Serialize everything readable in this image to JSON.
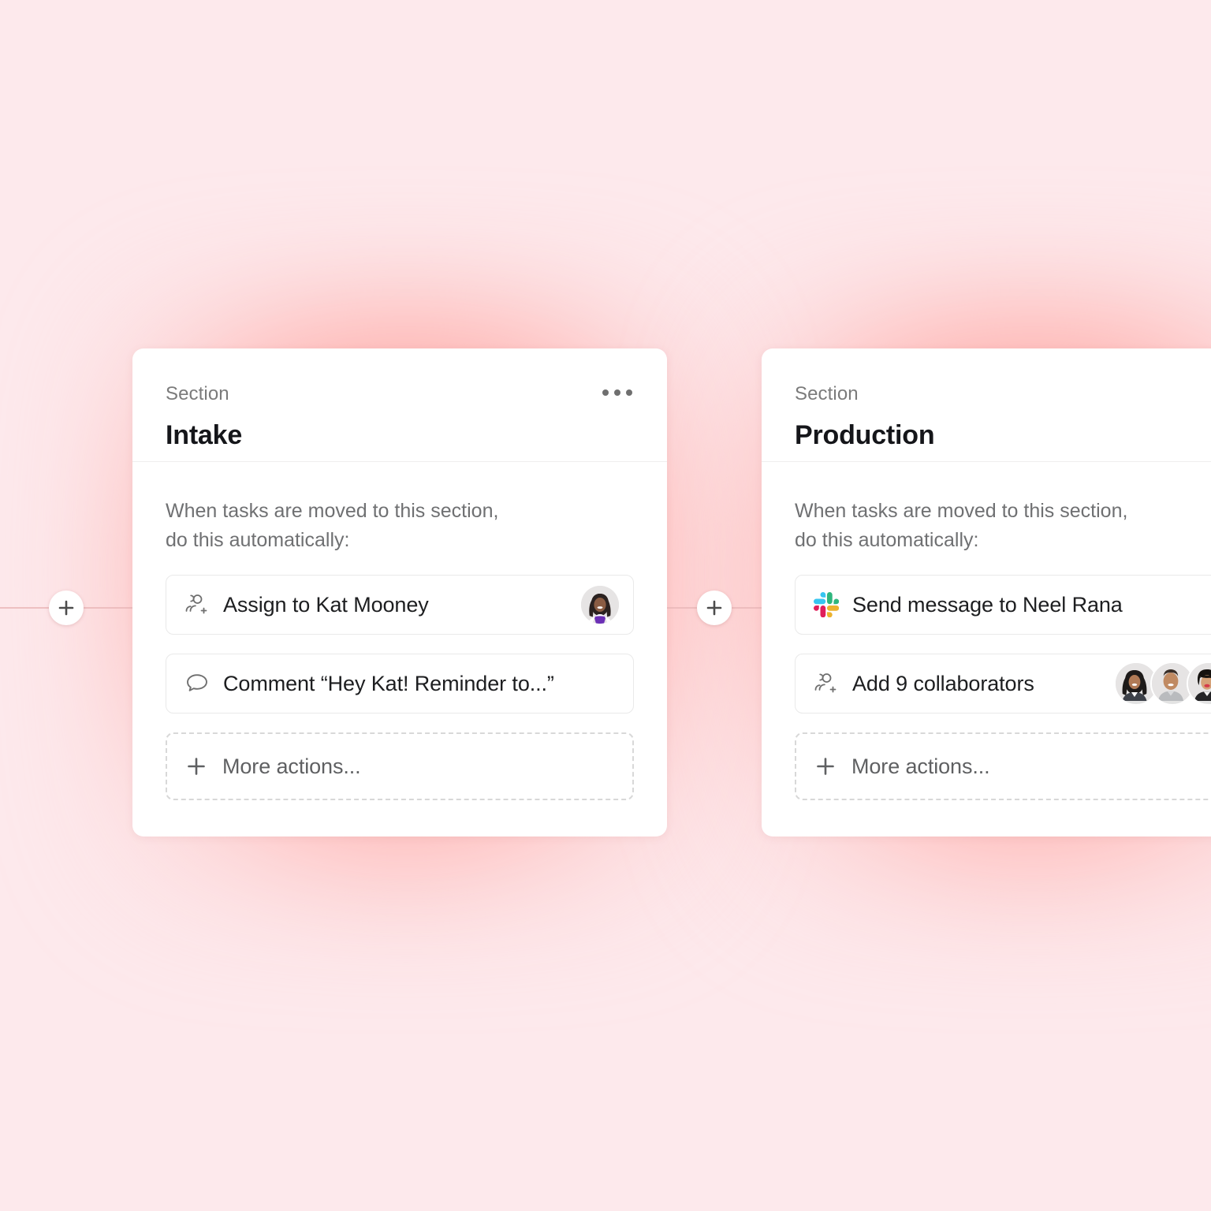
{
  "canvas": {
    "background_color": "#FDE9EC",
    "glow_color": "#FF9691"
  },
  "connectors": [
    {
      "name": "add-step-before-intake",
      "icon": "plus-icon",
      "label": "+"
    },
    {
      "name": "add-step-between-sections",
      "icon": "plus-icon",
      "label": "+"
    }
  ],
  "cards": [
    {
      "eyebrow": "Section",
      "title": "Intake",
      "menu_icon": "ellipsis-icon",
      "intro": "When tasks are moved to this section,\ndo this automatically:",
      "actions": [
        {
          "icon": "add-person-icon",
          "label": "Assign to Kat Mooney",
          "avatar": {
            "name": "Kat Mooney",
            "skin": "#8a5c43",
            "hair": "#2b2220",
            "shirt": "#6b2fb5"
          }
        },
        {
          "icon": "comment-bubble-icon",
          "label": "Comment “Hey Kat! Reminder to...”"
        }
      ],
      "more_actions": {
        "icon": "plus-icon",
        "label": "More actions..."
      }
    },
    {
      "eyebrow": "Section",
      "title": "Production",
      "intro": "When tasks are moved to this section,\ndo this automatically:",
      "actions": [
        {
          "icon": "slack-icon",
          "label": "Send message to Neel Rana"
        },
        {
          "icon": "add-person-icon",
          "label": "Add 9 collaborators",
          "avatar_stack": [
            {
              "name": "collaborator-1",
              "skin": "#b07a56",
              "hair": "#1d1a19",
              "shirt": "#3d4149"
            },
            {
              "name": "collaborator-2",
              "skin": "#c08a62",
              "hair": "#3a2f28",
              "shirt": "#b9bbbe"
            },
            {
              "name": "collaborator-3",
              "skin": "#d6a278",
              "hair": "#15120f",
              "shirt": "#242426"
            },
            {
              "name": "collaborator-4",
              "skin": "#c89773",
              "hair": "#241c18",
              "shirt": "#6b6e73"
            }
          ]
        }
      ],
      "more_actions": {
        "icon": "plus-icon",
        "label": "More actions..."
      }
    }
  ],
  "slack_colors": {
    "blue": "#36C5F0",
    "green": "#2EB67D",
    "red": "#E01E5A",
    "yellow": "#ECB22E"
  }
}
